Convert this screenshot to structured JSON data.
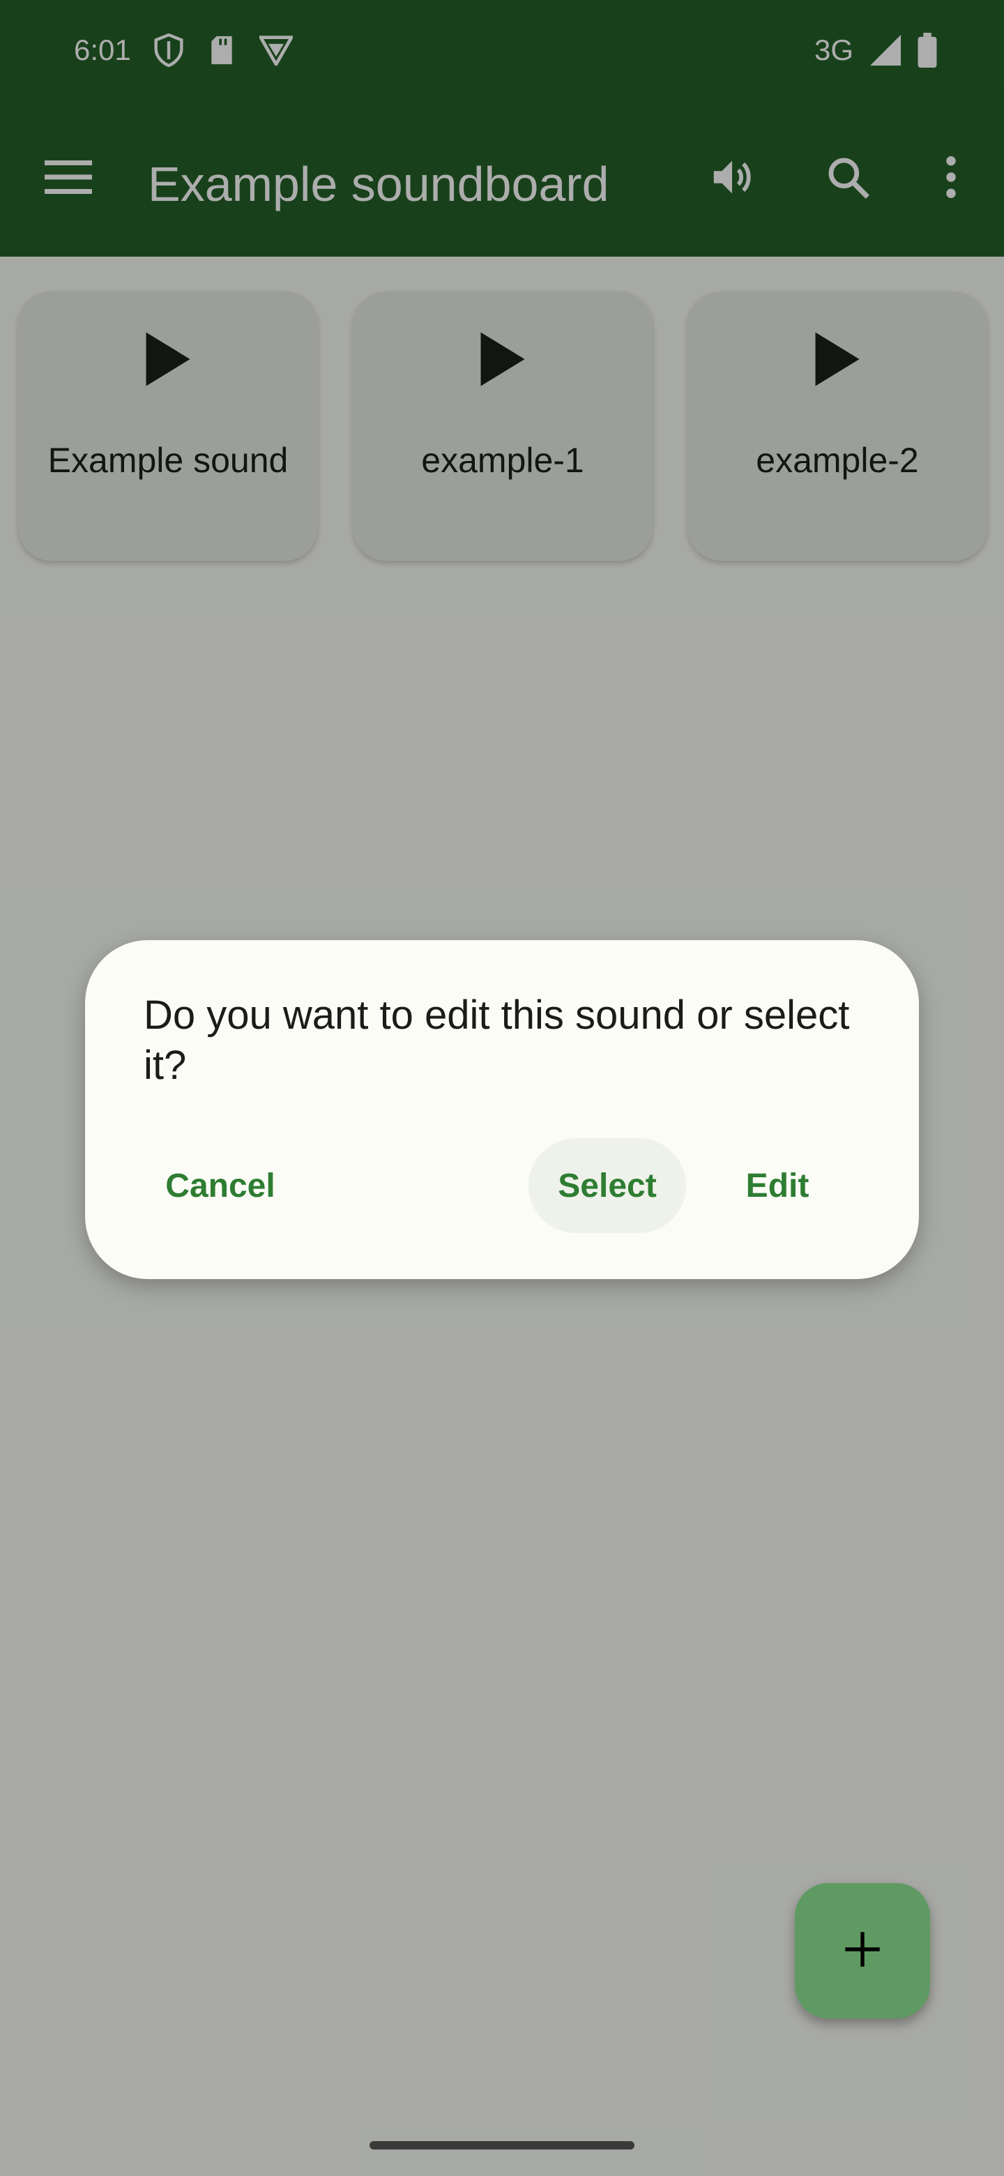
{
  "status_bar": {
    "time": "6:01",
    "network": "3G",
    "icons": [
      "shield-icon",
      "sd-card-icon",
      "vpn-icon",
      "signal-icon",
      "battery-icon"
    ]
  },
  "app_bar": {
    "title": "Example soundboard",
    "icons": [
      "menu-icon",
      "volume-icon",
      "search-icon",
      "more-vert-icon"
    ]
  },
  "sounds": [
    {
      "label": "Example sound"
    },
    {
      "label": "example-1"
    },
    {
      "label": "example-2"
    }
  ],
  "dialog": {
    "message": "Do you want to edit this sound or select it?",
    "cancel_label": "Cancel",
    "select_label": "Select",
    "edit_label": "Edit"
  },
  "fab": {
    "icon": "plus-icon"
  },
  "colors": {
    "primary": "#246128",
    "accent_text": "#2e7d32",
    "fab": "#8ee493",
    "card": "#e6ebe2",
    "dialog_bg": "#fbfcf6"
  }
}
